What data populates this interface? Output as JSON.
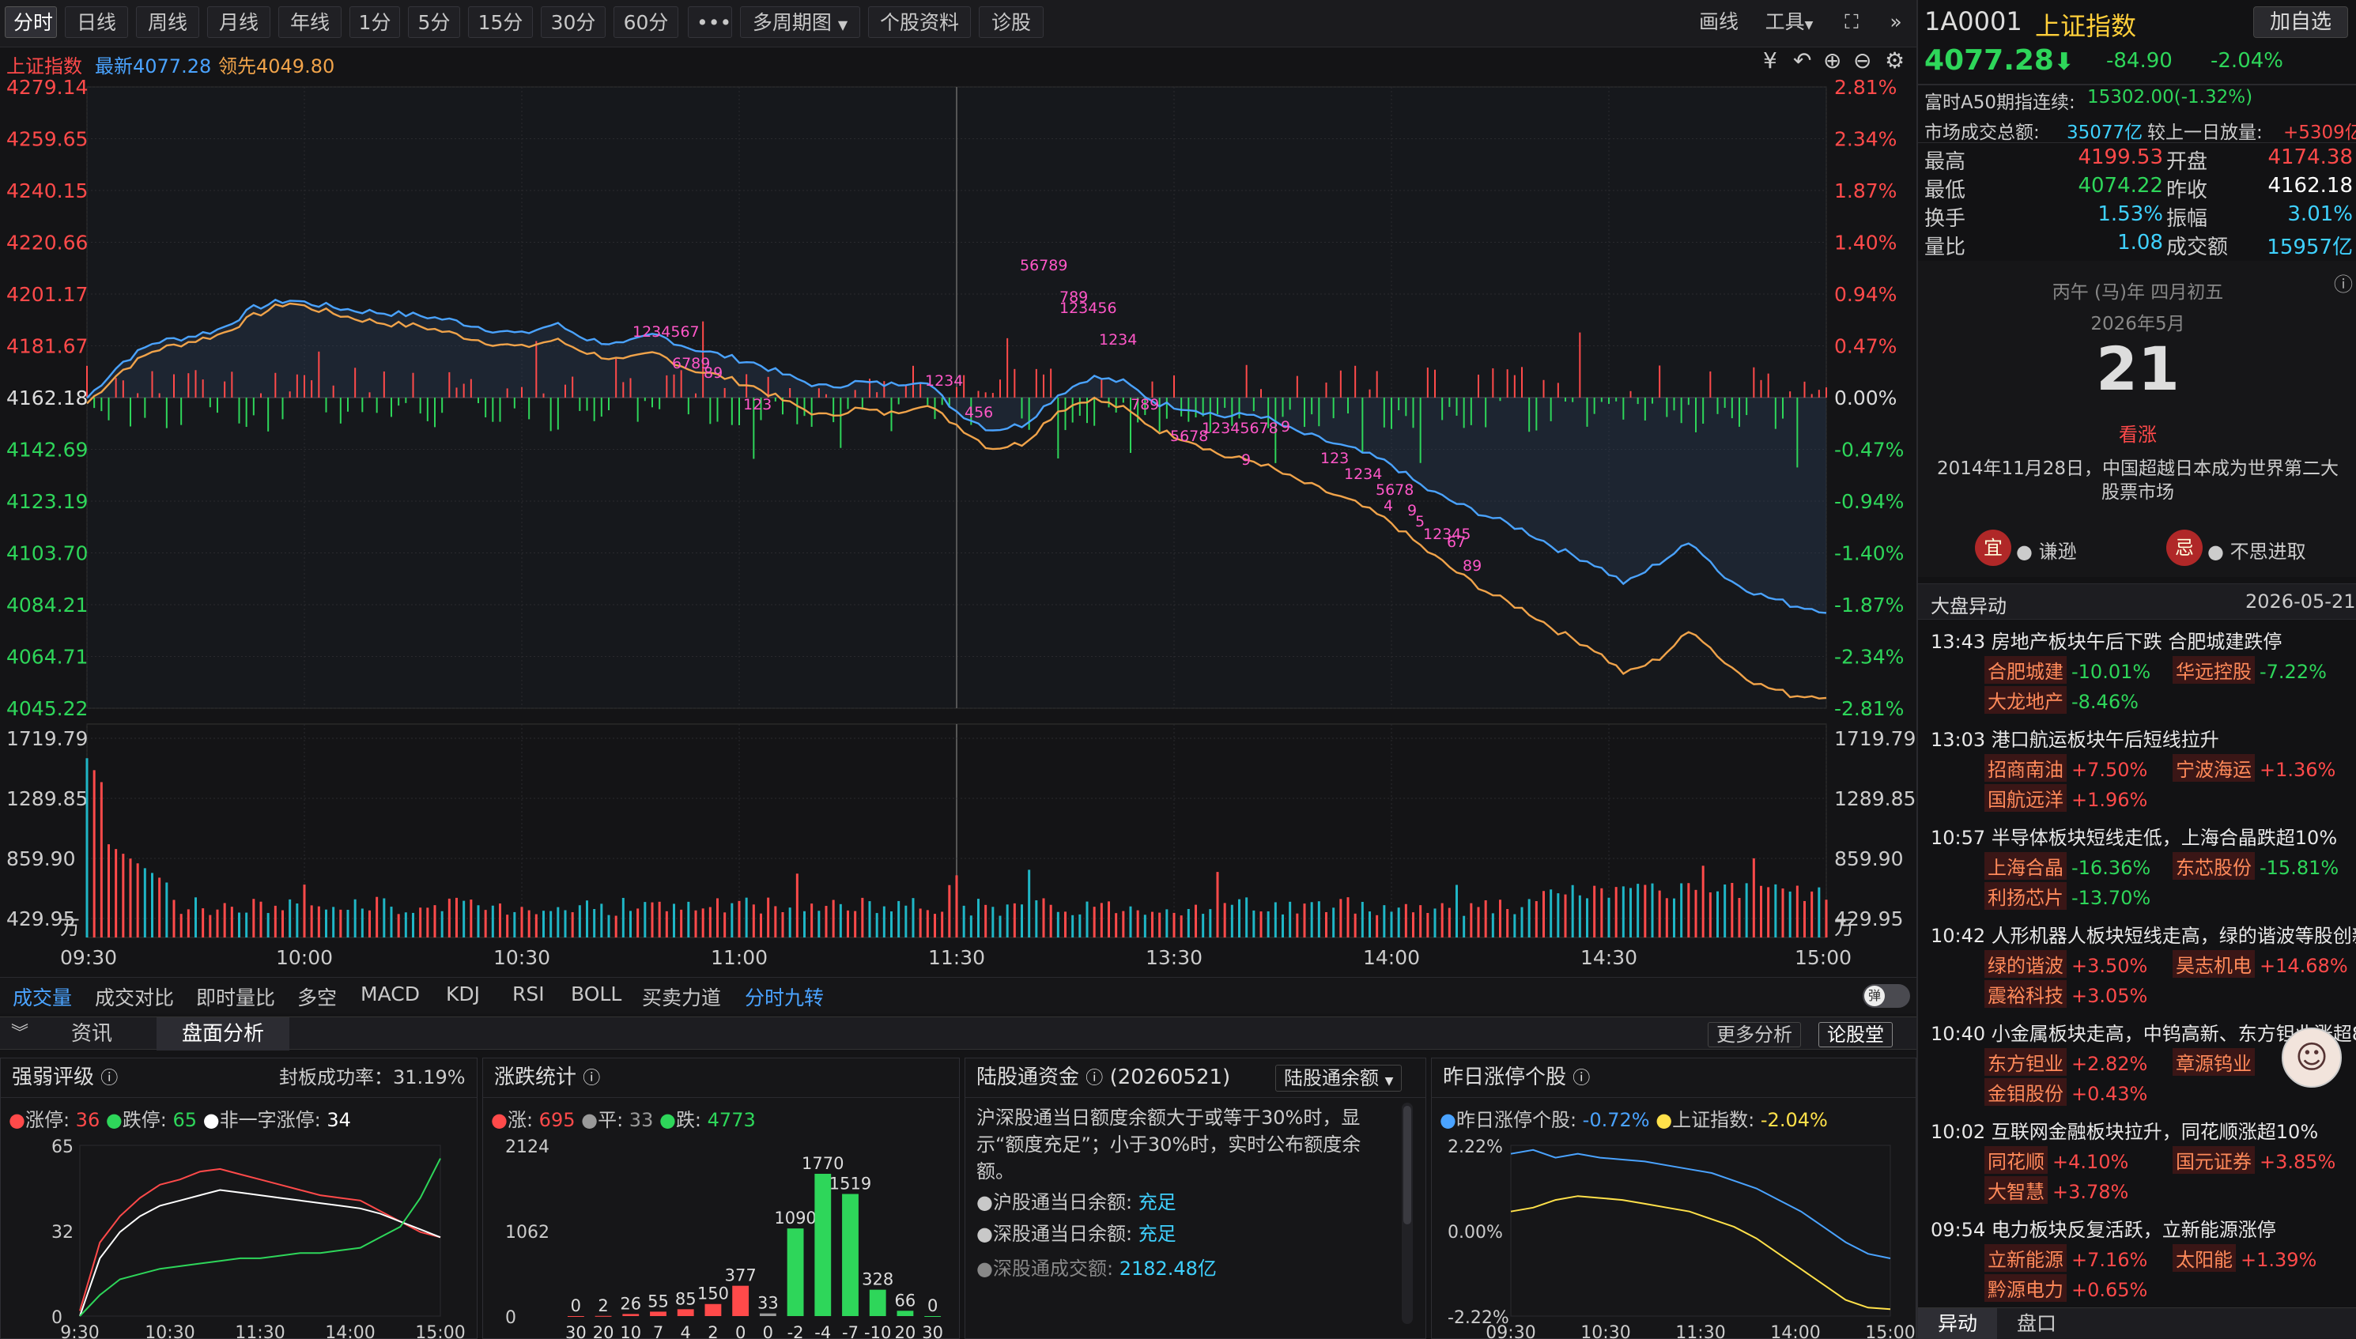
{
  "toolbar": {
    "periods": [
      "分时",
      "日线",
      "周线",
      "月线",
      "年线",
      "1分",
      "5分",
      "15分",
      "30分",
      "60分"
    ],
    "active": "分时",
    "more_icon": "more-dots-icon",
    "multi_period": "多周期图",
    "stock_info": "个股资料",
    "diagnose": "诊股",
    "draw": "画线",
    "tools": "工具",
    "fullscreen_icon": "fullscreen-icon",
    "collapse_icon": "double-chevron-right-icon"
  },
  "infoline": {
    "name": "上证指数",
    "latest": "最新4077.28",
    "leading": "领先4049.80"
  },
  "chart_icons": [
    "rmb-icon",
    "undo-icon",
    "zoom-in-icon",
    "zoom-out-icon",
    "gear-icon"
  ],
  "colors": {
    "up": "#ff4a4a",
    "down": "#2ed65a",
    "index_line": "#4aa3ff",
    "leading_line": "#f0a34a",
    "vol_up": "#ff4a4a",
    "vol_down": "#1fb6c6",
    "turn_marker": "#ff57c8"
  },
  "chart_data": [
    {
      "type": "line",
      "name": "intraday-price",
      "x_ticks": [
        "09:30",
        "10:00",
        "10:30",
        "11:00",
        "11:30",
        "13:30",
        "14:00",
        "14:30",
        "15:00"
      ],
      "y_left_ticks": [
        "4279.14",
        "4259.65",
        "4240.15",
        "4220.66",
        "4201.17",
        "4181.67",
        "4162.18",
        "4142.69",
        "4123.19",
        "4103.70",
        "4084.21",
        "4064.71",
        "4045.22"
      ],
      "y_right_ticks": [
        "2.81%",
        "2.34%",
        "1.87%",
        "1.40%",
        "0.94%",
        "0.47%",
        "0.00%",
        "-0.47%",
        "-0.94%",
        "-1.40%",
        "-1.87%",
        "-2.34%",
        "-2.81%"
      ],
      "ylim": [
        4045.22,
        4279.14
      ],
      "prev_close": 4162.18,
      "series": [
        {
          "values": [
            4162,
            4175,
            4183,
            4185,
            4188,
            4196,
            4199,
            4197,
            4195,
            4194,
            4193,
            4191,
            4188,
            4186,
            4190,
            4184,
            4182,
            4186,
            4181,
            4178,
            4175,
            4170,
            4166,
            4168,
            4167,
            4169,
            4157,
            4150,
            4152,
            4163,
            4170,
            4168,
            4160,
            4158,
            4155,
            4156,
            4150,
            4146,
            4142,
            4137,
            4128,
            4122,
            4117,
            4112,
            4105,
            4100,
            4092,
            4100,
            4108,
            4094,
            4088,
            4084,
            4082
          ]
        },
        {
          "values": [
            4160,
            4172,
            4180,
            4183,
            4186,
            4193,
            4198,
            4195,
            4192,
            4190,
            4189,
            4186,
            4183,
            4181,
            4184,
            4179,
            4176,
            4179,
            4173,
            4170,
            4166,
            4160,
            4155,
            4158,
            4156,
            4160,
            4152,
            4143,
            4145,
            4157,
            4162,
            4158,
            4150,
            4146,
            4140,
            4138,
            4132,
            4127,
            4122,
            4115,
            4105,
            4096,
            4088,
            4082,
            4074,
            4068,
            4058,
            4064,
            4075,
            4062,
            4054,
            4050,
            4050
          ]
        }
      ],
      "nine_turn_labels": [
        "1234567",
        "89",
        "1234",
        "56789",
        "123456",
        "789",
        "12345678",
        "9",
        "1234",
        "5678",
        "9",
        "12345",
        "6789",
        "123",
        "456",
        "789",
        "1234",
        "5678",
        "9",
        "123",
        "4",
        "5",
        "67",
        "89"
      ]
    },
    {
      "type": "bar",
      "name": "intraday-volume",
      "y_ticks": [
        "1719.79",
        "1289.85",
        "859.90",
        "429.95"
      ],
      "unit": "万",
      "ylim": [
        0,
        1719.79
      ]
    },
    {
      "type": "line",
      "name": "strength-rating",
      "title": "强弱评级",
      "seal_rate_label": "封板成功率：",
      "seal_rate": "31.19%",
      "legend": [
        "涨停: ",
        "36",
        "跌停: ",
        "65",
        "非一字涨停: ",
        "34"
      ],
      "y_ticks": [
        "65",
        "32",
        "0"
      ],
      "x_ticks": [
        "9:30",
        "10:30",
        "11:30",
        "14:00",
        "15:00"
      ],
      "series": [
        {
          "values": [
            2,
            28,
            38,
            45,
            50,
            52,
            55,
            56,
            54,
            52,
            50,
            48,
            46,
            45,
            44,
            40,
            36,
            32,
            30
          ]
        },
        {
          "values": [
            0,
            22,
            32,
            38,
            42,
            44,
            46,
            48,
            47,
            46,
            45,
            44,
            43,
            42,
            41,
            39,
            36,
            33,
            30
          ]
        },
        {
          "values": [
            0,
            8,
            14,
            16,
            18,
            19,
            20,
            21,
            22,
            22,
            23,
            24,
            24,
            25,
            26,
            30,
            34,
            45,
            60
          ]
        }
      ]
    },
    {
      "type": "bar",
      "name": "rise-fall-stats",
      "title": "涨跌统计",
      "legend": [
        "涨: ",
        "695",
        "平: ",
        "33",
        "跌: ",
        "4773"
      ],
      "y_ticks": [
        "2124",
        "1062",
        "0"
      ],
      "x_labels": [
        "30",
        "20",
        "10",
        "7",
        "4",
        "2",
        "0",
        "0",
        "-2",
        "-4",
        "-7",
        "-10",
        "20",
        "30"
      ],
      "values": [
        0,
        2,
        26,
        55,
        85,
        150,
        377,
        33,
        1090,
        1770,
        1519,
        328,
        66,
        0
      ],
      "value_labels": [
        "0",
        "2",
        "26",
        "55",
        "85",
        "150",
        "377",
        "33",
        "1090",
        "1770",
        "1519",
        "328",
        "66",
        "0"
      ]
    },
    {
      "type": "line",
      "name": "limit-up-yesterday",
      "title": "昨日涨停个股",
      "legend": [
        "昨日涨停个股: ",
        "-0.72%",
        "上证指数: ",
        "-2.04%"
      ],
      "y_ticks": [
        "2.22%",
        "0.00%",
        "-2.22%"
      ],
      "x_ticks": [
        "09:30",
        "10:30",
        "11:30",
        "14:00",
        "15:00"
      ],
      "series": [
        {
          "values": [
            2.0,
            2.1,
            1.9,
            2.0,
            1.9,
            1.85,
            1.8,
            1.7,
            1.6,
            1.5,
            1.3,
            1.1,
            0.8,
            0.5,
            0.1,
            -0.3,
            -0.6,
            -0.72
          ]
        },
        {
          "values": [
            0.5,
            0.6,
            0.8,
            0.9,
            0.85,
            0.8,
            0.7,
            0.6,
            0.5,
            0.3,
            0.1,
            -0.2,
            -0.6,
            -1.0,
            -1.4,
            -1.8,
            -2.0,
            -2.04
          ]
        }
      ]
    }
  ],
  "indicators": [
    "成交量",
    "成交对比",
    "即时量比",
    "多空",
    "MACD",
    "KDJ",
    "RSI",
    "BOLL",
    "买卖力道",
    "分时九转"
  ],
  "indicator_active": "成交量",
  "toggle_label": "弹",
  "bottom_tabs": {
    "collapse_icon": "double-chevron-down-icon",
    "tabs": [
      "资讯",
      "盘面分析"
    ],
    "active": "盘面分析",
    "more": "更多分析",
    "forum": "论股堂"
  },
  "panels": {
    "strength": {
      "info_icon": "info-icon"
    },
    "risefall": {
      "info_icon": "info-icon"
    },
    "hsgt": {
      "title": "陆股通资金",
      "date": "(20260521)",
      "select": "陆股通余额",
      "desc": "沪深股通当日额度余额大于或等于30%时，显示“额度充足”；小于30%时，实时公布额度余额。",
      "sh_label": "沪股通当日余额:",
      "sh_value": "充足",
      "sz_label": "深股通当日余额:",
      "sz_value": "充足",
      "deal_label": "深股通成交额:",
      "deal_value": "2182.48亿"
    },
    "limitup": {
      "info_icon": "info-icon"
    }
  },
  "right": {
    "code": "1A0001",
    "name": "上证指数",
    "add_btn": "加自选",
    "price": "4077.28",
    "change": "-84.90",
    "pct": "-2.04%",
    "a50_label": "富时A50期指连续:",
    "a50_value": "15302.00(-1.32%)",
    "turnover_label": "市场成交总额:",
    "turnover_value": "35077亿",
    "vol_change_label": "较上一日放量:",
    "vol_change_value": "+5309亿",
    "quotes": [
      {
        "l1": "最高",
        "v1": "4199.53",
        "l2": "开盘",
        "v2": "4174.38"
      },
      {
        "l1": "最低",
        "v1": "4074.22",
        "l2": "昨收",
        "v2": "4162.18"
      },
      {
        "l1": "换手",
        "v1": "1.53%",
        "l2": "振幅",
        "v2": "3.01%"
      },
      {
        "l1": "量比",
        "v1": "1.08",
        "l2": "成交额",
        "v2": "15957亿"
      }
    ],
    "calendar": {
      "lunar": "丙午 (马)年 四月初五",
      "month": "2026年5月",
      "day": "21",
      "mood": "看涨",
      "history": "2014年11月28日，中国超越日本成为世界第二大股票市场",
      "yi_badge": "宜",
      "yi_text": "谦逊",
      "ji_badge": "忌",
      "ji_text": "不思进取"
    },
    "news_header": "大盘异动",
    "news_date": "2026-05-21",
    "news": [
      {
        "time": "13:43",
        "text": "房地产板块午后下跌 合肥城建跌停",
        "stocks": [
          [
            "合肥城建",
            "-10.01%"
          ],
          [
            "华远控股",
            "-7.22%"
          ],
          [
            "大龙地产",
            "-8.46%"
          ]
        ]
      },
      {
        "time": "13:03",
        "text": "港口航运板块午后短线拉升",
        "stocks": [
          [
            "招商南油",
            "+7.50%"
          ],
          [
            "宁波海运",
            "+1.36%"
          ],
          [
            "国航远洋",
            "+1.96%"
          ]
        ]
      },
      {
        "time": "10:57",
        "text": "半导体板块短线走低，上海合晶跌超10%",
        "stocks": [
          [
            "上海合晶",
            "-16.36%"
          ],
          [
            "东芯股份",
            "-15.81%"
          ],
          [
            "利扬芯片",
            "-13.70%"
          ]
        ]
      },
      {
        "time": "10:42",
        "text": "人形机器人板块短线走高，绿的谐波等股创新",
        "stocks": [
          [
            "绿的谐波",
            "+3.50%"
          ],
          [
            "昊志机电",
            "+14.68%"
          ],
          [
            "震裕科技",
            "+3.05%"
          ]
        ]
      },
      {
        "time": "10:40",
        "text": "小金属板块走高，中钨高新、东方钽业涨超8",
        "stocks": [
          [
            "东方钽业",
            "+2.82%"
          ],
          [
            "章源钨业",
            ""
          ],
          [
            "金钼股份",
            "+0.43%"
          ]
        ]
      },
      {
        "time": "10:02",
        "text": "互联网金融板块拉升，同花顺涨超10%",
        "stocks": [
          [
            "同花顺",
            "+4.10%"
          ],
          [
            "国元证券",
            "+3.85%"
          ],
          [
            "大智慧",
            "+3.78%"
          ]
        ]
      },
      {
        "time": "09:54",
        "text": "电力板块反复活跃，立新能源涨停",
        "stocks": [
          [
            "立新能源",
            "+7.16%"
          ],
          [
            "太阳能",
            "+1.39%"
          ],
          [
            "黔源电力",
            "+0.65%"
          ]
        ]
      }
    ],
    "bottom_tabs": [
      "异动",
      "盘口"
    ]
  }
}
